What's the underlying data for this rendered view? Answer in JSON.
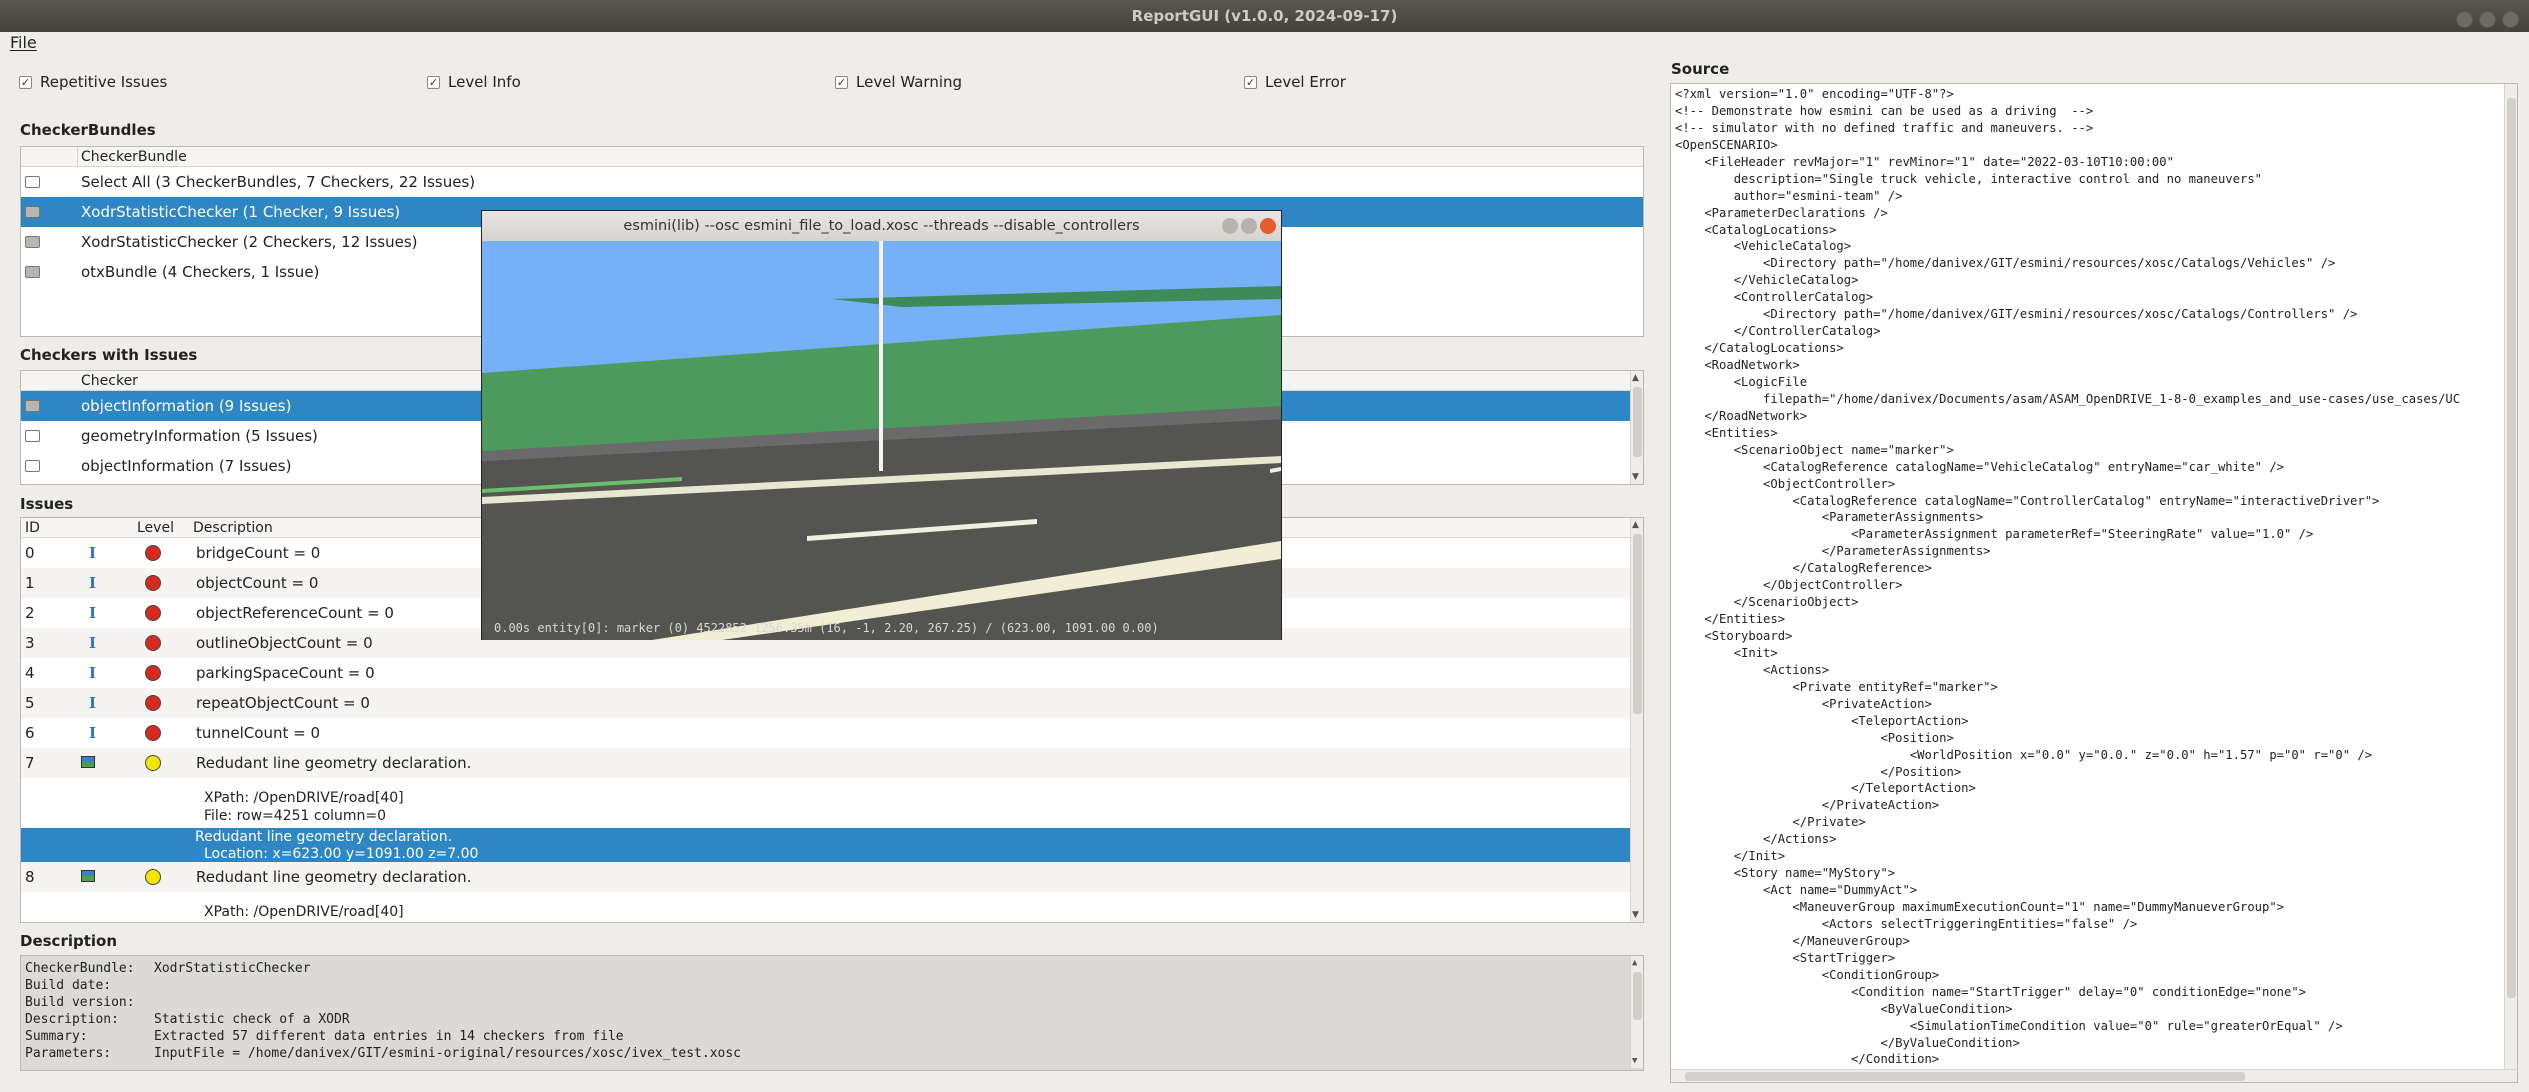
{
  "window": {
    "title": "ReportGUI (v1.0.0, 2024-09-17)"
  },
  "menu": {
    "file": "File"
  },
  "filters": [
    {
      "label": "Repetitive Issues",
      "checked": true
    },
    {
      "label": "Level Info",
      "checked": true
    },
    {
      "label": "Level Warning",
      "checked": true
    },
    {
      "label": "Level Error",
      "checked": true
    }
  ],
  "checker_bundles": {
    "title": "CheckerBundles",
    "column": "CheckerBundle",
    "rows": [
      {
        "label": "Select All (3 CheckerBundles, 7 Checkers, 22 Issues)",
        "selected": false
      },
      {
        "label": "XodrStatisticChecker (1 Checker, 9 Issues)",
        "selected": true
      },
      {
        "label": "XodrStatisticChecker (2 Checkers, 12 Issues)",
        "selected": false
      },
      {
        "label": "otxBundle (4 Checkers, 1 Issue)",
        "selected": false
      }
    ]
  },
  "checkers": {
    "title": "Checkers with Issues",
    "column": "Checker",
    "rows": [
      {
        "label": "objectInformation (9 Issues)",
        "selected": true
      },
      {
        "label": "geometryInformation (5 Issues)",
        "selected": false
      },
      {
        "label": "objectInformation (7 Issues)",
        "selected": false
      }
    ]
  },
  "issues": {
    "title": "Issues",
    "columns": {
      "id": "ID",
      "level": "Level",
      "description": "Description"
    },
    "rows": [
      {
        "id": "0",
        "icon": "I",
        "level": "error",
        "description": "bridgeCount = 0"
      },
      {
        "id": "1",
        "icon": "I",
        "level": "error",
        "description": "objectCount = 0"
      },
      {
        "id": "2",
        "icon": "I",
        "level": "error",
        "description": "objectReferenceCount = 0"
      },
      {
        "id": "3",
        "icon": "I",
        "level": "error",
        "description": "outlineObjectCount = 0"
      },
      {
        "id": "4",
        "icon": "I",
        "level": "error",
        "description": "parkingSpaceCount = 0"
      },
      {
        "id": "5",
        "icon": "I",
        "level": "error",
        "description": "repeatObjectCount = 0"
      },
      {
        "id": "6",
        "icon": "I",
        "level": "error",
        "description": "tunnelCount = 0"
      },
      {
        "id": "7",
        "icon": "map",
        "level": "warning",
        "description": "Redudant line geometry declaration."
      }
    ],
    "detail7": {
      "xpath": "XPath: /OpenDRIVE/road[40]",
      "file": "File: row=4251 column=0",
      "sel_desc": "Redudant line geometry declaration.",
      "sel_loc": "Location: x=623.00 y=1091.00 z=7.00"
    },
    "row8": {
      "id": "8",
      "description": "Redudant line geometry declaration.",
      "xpath": "XPath: /OpenDRIVE/road[40]"
    }
  },
  "description": {
    "title": "Description",
    "lines": [
      {
        "k": "CheckerBundle:",
        "v": "XodrStatisticChecker"
      },
      {
        "k": "Build date:",
        "v": ""
      },
      {
        "k": "Build version:",
        "v": ""
      },
      {
        "k": "Description:",
        "v": "Statistic check of a XODR"
      },
      {
        "k": "Summary:",
        "v": "Extracted 57 different data entries in 14 checkers from file"
      },
      {
        "k": "Parameters:",
        "v": "InputFile = /home/danivex/GIT/esmini-original/resources/xosc/ivex_test.xosc"
      }
    ]
  },
  "source": {
    "title": "Source",
    "lines": [
      "<?xml version=\"1.0\" encoding=\"UTF-8\"?>",
      "<!-- Demonstrate how esmini can be used as a driving  -->",
      "<!-- simulator with no defined traffic and maneuvers. -->",
      "<OpenSCENARIO>",
      "    <FileHeader revMajor=\"1\" revMinor=\"1\" date=\"2022-03-10T10:00:00\"",
      "        description=\"Single truck vehicle, interactive control and no maneuvers\"",
      "        author=\"esmini-team\" />",
      "    <ParameterDeclarations />",
      "    <CatalogLocations>",
      "        <VehicleCatalog>",
      "            <Directory path=\"/home/danivex/GIT/esmini/resources/xosc/Catalogs/Vehicles\" />",
      "        </VehicleCatalog>",
      "        <ControllerCatalog>",
      "            <Directory path=\"/home/danivex/GIT/esmini/resources/xosc/Catalogs/Controllers\" />",
      "        </ControllerCatalog>",
      "    </CatalogLocations>",
      "    <RoadNetwork>",
      "        <LogicFile",
      "            filepath=\"/home/danivex/Documents/asam/ASAM_OpenDRIVE_1-8-0_examples_and_use-cases/use_cases/UC",
      "    </RoadNetwork>",
      "    <Entities>",
      "        <ScenarioObject name=\"marker\">",
      "            <CatalogReference catalogName=\"VehicleCatalog\" entryName=\"car_white\" />",
      "            <ObjectController>",
      "                <CatalogReference catalogName=\"ControllerCatalog\" entryName=\"interactiveDriver\">",
      "                    <ParameterAssignments>",
      "                        <ParameterAssignment parameterRef=\"SteeringRate\" value=\"1.0\" />",
      "                    </ParameterAssignments>",
      "                </CatalogReference>",
      "            </ObjectController>",
      "        </ScenarioObject>",
      "    </Entities>",
      "    <Storyboard>",
      "        <Init>",
      "            <Actions>",
      "                <Private entityRef=\"marker\">",
      "                    <PrivateAction>",
      "                        <TeleportAction>",
      "                            <Position>",
      "                                <WorldPosition x=\"0.0\" y=\"0.0.\" z=\"0.0\" h=\"1.57\" p=\"0\" r=\"0\" />",
      "                            </Position>",
      "                        </TeleportAction>",
      "                    </PrivateAction>",
      "                </Private>",
      "            </Actions>",
      "        </Init>",
      "        <Story name=\"MyStory\">",
      "            <Act name=\"DummyAct\">",
      "                <ManeuverGroup maximumExecutionCount=\"1\" name=\"DummyManueverGroup\">",
      "                    <Actors selectTriggeringEntities=\"false\" />",
      "                </ManeuverGroup>",
      "                <StartTrigger>",
      "                    <ConditionGroup>",
      "                        <Condition name=\"StartTrigger\" delay=\"0\" conditionEdge=\"none\">",
      "                            <ByValueCondition>",
      "                                <SimulationTimeCondition value=\"0\" rule=\"greaterOrEqual\" />",
      "                            </ByValueCondition>",
      "                        </Condition>"
    ]
  },
  "viewer": {
    "title": "esmini(lib) --osc esmini_file_to_load.xosc --threads --disable_controllers",
    "status": "0.00s entity[0]: marker (0) 4522852 1256.35m (16, -1, 2.20, 267.25) / (623.00, 1091.00 0.00)"
  }
}
